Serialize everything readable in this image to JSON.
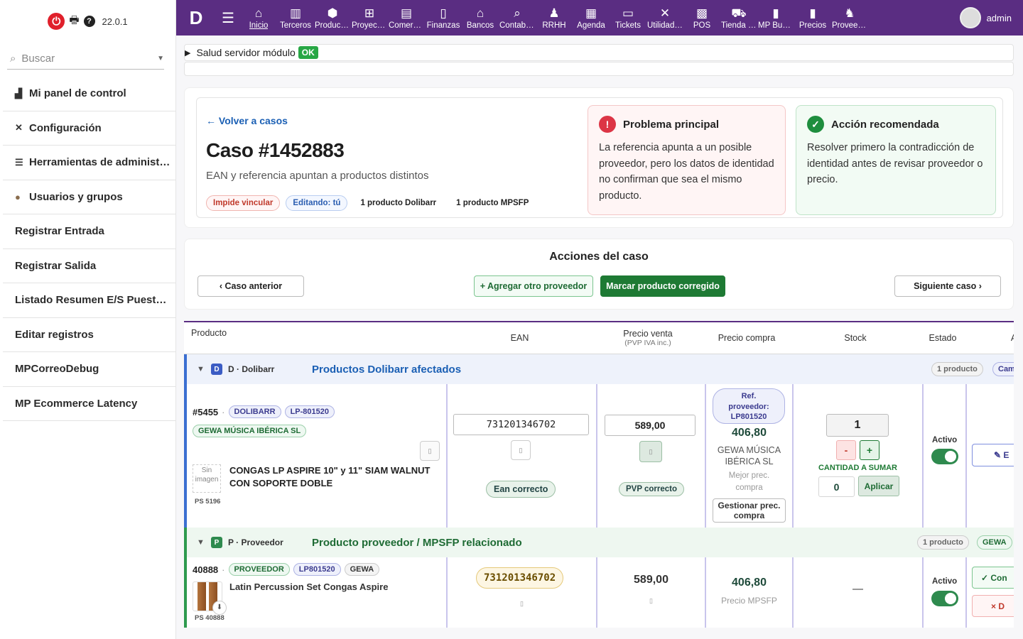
{
  "sidebar": {
    "version": "22.0.1",
    "search_placeholder": "Buscar",
    "items": [
      {
        "label": "Mi panel de control",
        "icon": "chart-icon"
      },
      {
        "label": "Configuración",
        "icon": "tools-icon"
      },
      {
        "label": "Herramientas de administración",
        "icon": "server-icon"
      },
      {
        "label": "Usuarios y grupos",
        "icon": "user-icon"
      },
      {
        "label": "Registrar Entrada"
      },
      {
        "label": "Registrar Salida"
      },
      {
        "label": "Listado Resumen E/S Puesto de trabajo"
      },
      {
        "label": "Editar registros"
      },
      {
        "label": "MPCorreoDebug"
      },
      {
        "label": "MP Ecommerce Latency"
      }
    ]
  },
  "topbar": {
    "logo": "D",
    "user": "admin",
    "items": [
      {
        "label": "Inicio",
        "icon": "home-icon",
        "active": true
      },
      {
        "label": "Terceros",
        "icon": "building-icon"
      },
      {
        "label": "Productos",
        "icon": "cube-icon"
      },
      {
        "label": "Proyectos",
        "icon": "sitemap-icon"
      },
      {
        "label": "Comercial",
        "icon": "briefcase-icon"
      },
      {
        "label": "Finanzas",
        "icon": "invoice-icon"
      },
      {
        "label": "Bancos",
        "icon": "bank-icon"
      },
      {
        "label": "Contabilidad",
        "icon": "search-dollar-icon"
      },
      {
        "label": "RRHH",
        "icon": "user-tie-icon"
      },
      {
        "label": "Agenda",
        "icon": "calendar-icon"
      },
      {
        "label": "Tickets",
        "icon": "ticket-icon"
      },
      {
        "label": "Utilidades",
        "icon": "wrench-icon"
      },
      {
        "label": "POS",
        "icon": "cash-register-icon"
      },
      {
        "label": "Tienda online",
        "icon": "cart-icon"
      },
      {
        "label": "MP Buscador",
        "icon": "file-icon"
      },
      {
        "label": "Precios",
        "icon": "file-icon"
      },
      {
        "label": "Proveedores",
        "icon": "users-icon"
      }
    ]
  },
  "health": {
    "label": "Salud servidor módulo",
    "status": "OK"
  },
  "case": {
    "back": "← Volver a casos",
    "title": "Caso #1452883",
    "subtitle": "EAN y referencia apuntan a productos distintos",
    "pills": [
      "Impide vincular",
      "Editando: tú",
      "1 producto Dolibarr",
      "1 producto MPSFP"
    ],
    "problem": {
      "title": "Problema principal",
      "text": "La referencia apunta a un posible proveedor, pero los datos de identidad no confirman que sea el mismo producto."
    },
    "action": {
      "title": "Acción recomendada",
      "text": "Resolver primero la contradicción de identidad antes de revisar proveedor o precio."
    }
  },
  "actions": {
    "title": "Acciones del caso",
    "prev": "‹ Caso anterior",
    "add_supplier": "+ Agregar otro proveedor",
    "mark_fixed": "Marcar producto corregido",
    "next": "Siguiente caso ›"
  },
  "table": {
    "headers": {
      "product": "Producto",
      "ean": "EAN",
      "price": "Precio venta",
      "price_sub": "(PVP IVA inc.)",
      "cost": "Precio compra",
      "stock": "Stock",
      "status": "Estado",
      "actions": "A"
    },
    "dolibarr_group": {
      "letter": "D",
      "name": "D · Dolibarr",
      "title": "Productos Dolibarr afectados",
      "count": "1 producto",
      "extra": "Cam"
    },
    "supplier_group": {
      "letter": "P",
      "name": "P · Proveedor",
      "title": "Producto proveedor / MPSFP relacionado",
      "count": "1 producto",
      "extra": "GEWA"
    },
    "dol_row": {
      "id": "#5455",
      "tag1": "DOLIBARR",
      "tag2": "LP-801520",
      "supplier": "GEWA MÚSICA IBÉRICA SL",
      "no_image": "Sin imagen",
      "ps": "PS 5196",
      "name": "CONGAS LP ASPIRE 10\" y 11\" SIAM WALNUT CON SOPORTE DOBLE",
      "ean": "731201346702",
      "ean_ok": "Ean correcto",
      "price": "589,00",
      "price_ok": "PVP correcto",
      "cost_ref": "Ref. proveedor: LP801520",
      "cost": "406,80",
      "cost_supplier": "GEWA MÚSICA IBÉRICA SL",
      "cost_best": "Mejor prec. compra",
      "cost_btn": "Gestionar prec. compra",
      "stock": "1",
      "minus": "-",
      "plus": "+",
      "qty_label": "CANTIDAD A SUMAR",
      "qty": "0",
      "apply": "Aplicar",
      "status_label": "Activo",
      "edit": "✎ E"
    },
    "prv_row": {
      "id": "40888",
      "tag1": "PROVEEDOR",
      "tag2": "LP801520",
      "tag3": "GEWA",
      "ps": "PS 40888",
      "name": "Latin Percussion Set Congas Aspire",
      "ean": "731201346702",
      "price": "589,00",
      "cost": "406,80",
      "cost_label": "Precio MPSFP",
      "stock": "—",
      "status_label": "Activo",
      "confirm": "✓ Con",
      "discard": "× D"
    }
  }
}
